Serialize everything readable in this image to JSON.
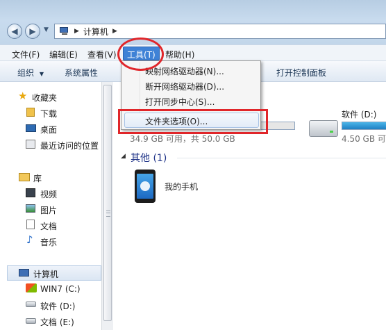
{
  "address": {
    "crumbs": [
      "计算机"
    ]
  },
  "menubar": {
    "file": "文件(F)",
    "edit": "编辑(E)",
    "view": "查看(V)",
    "tools": "工具(T)",
    "help": "帮助(H)"
  },
  "toolbar": {
    "organize": "组织",
    "system_properties": "系统属性",
    "open_control_panel": "打开控制面板"
  },
  "nav": {
    "favorites": "收藏夹",
    "downloads": "下载",
    "desktop": "桌面",
    "recent": "最近访问的位置",
    "libraries": "库",
    "videos": "视频",
    "pictures": "图片",
    "documents": "文档",
    "music": "音乐",
    "computer": "计算机",
    "drive_c": "WIN7 (C:)",
    "drive_d": "软件 (D:)",
    "drive_e": "文档 (E:)"
  },
  "content": {
    "drive_c_free": "34.9 GB 可用，共 50.0 GB",
    "drive_d_name": "软件 (D:)",
    "drive_d_free": "4.50 GB 可",
    "drive_c_used_fraction": 0.3,
    "drive_d_used_fraction": 0.95,
    "other_section": "其他 (1)",
    "phone_name": "我的手机"
  },
  "tools_menu": {
    "map_drive": "映射网络驱动器(N)...",
    "disconnect_drive": "断开网络驱动器(D)...",
    "open_sync_center": "打开同步中心(S)...",
    "folder_options": "文件夹选项(O)..."
  },
  "colors": {
    "highlight": "#3f82d6",
    "annotation_red": "#e0262a",
    "capacity_bar": "#1f7fc2"
  }
}
